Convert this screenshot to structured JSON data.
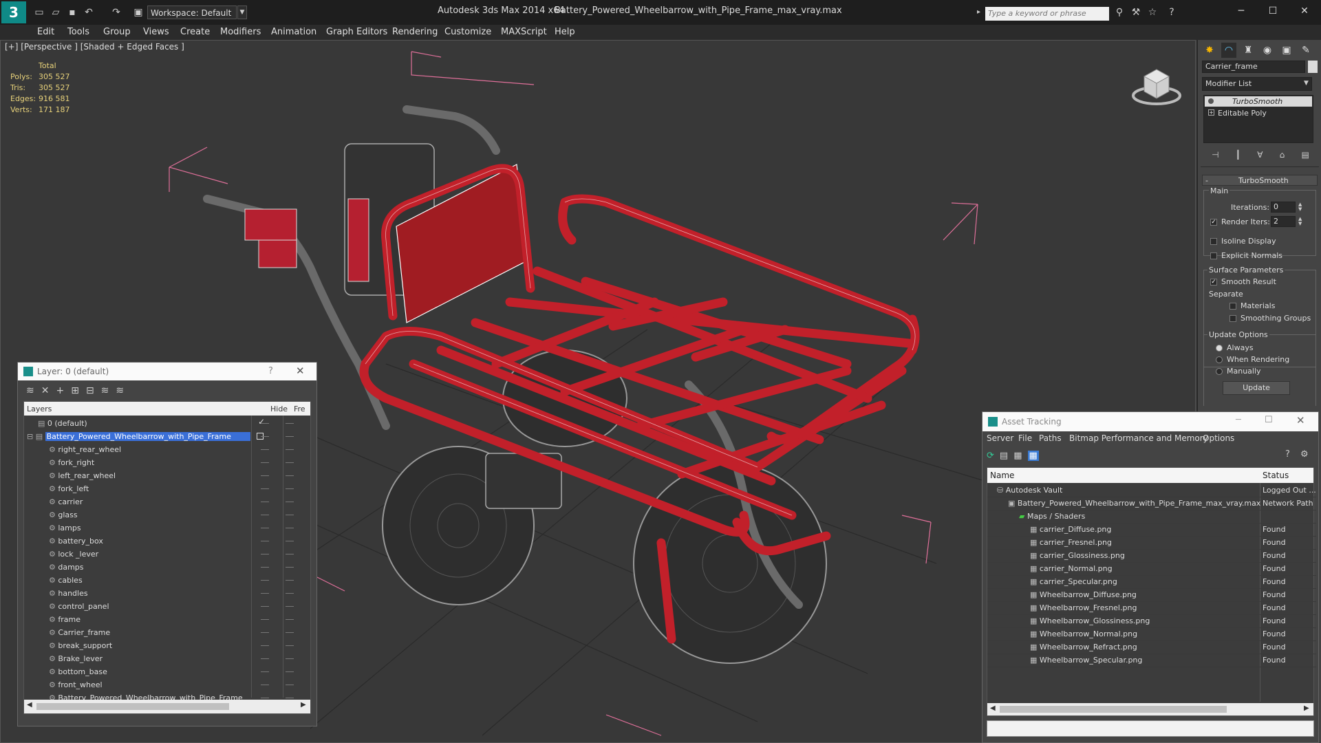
{
  "titlebar": {
    "app_title": "Autodesk 3ds Max  2014 x64",
    "doc_title": "Battery_Powered_Wheelbarrow_with_Pipe_Frame_max_vray.max",
    "workspace": "Workspace: Default",
    "search_placeholder": "Type a keyword or phrase"
  },
  "menu": [
    "Edit",
    "Tools",
    "Group",
    "Views",
    "Create",
    "Modifiers",
    "Animation",
    "Graph Editors",
    "Rendering",
    "Customize",
    "MAXScript",
    "Help"
  ],
  "viewport": {
    "label": "[+] [Perspective ] [Shaded + Edged Faces ]",
    "stats": {
      "header": "Total",
      "rows": [
        {
          "label": "Polys:",
          "value": "305 527"
        },
        {
          "label": "Tris:",
          "value": "305 527"
        },
        {
          "label": "Edges:",
          "value": "916 581"
        },
        {
          "label": "Verts:",
          "value": "171 187"
        }
      ]
    }
  },
  "command_panel": {
    "object_name": "Carrier_frame",
    "modifier_list": "Modifier List",
    "stack": [
      "TurboSmooth",
      "Editable Poly"
    ],
    "rollout_title": "TurboSmooth",
    "main_label": "Main",
    "iterations_label": "Iterations:",
    "iterations_value": "0",
    "render_iters_label": "Render Iters:",
    "render_iters_value": "2",
    "isoline": "Isoline Display",
    "explicit_normals": "Explicit Normals",
    "surface_params": "Surface Parameters",
    "smooth_result": "Smooth Result",
    "separate": "Separate",
    "materials": "Materials",
    "smoothing_groups": "Smoothing Groups",
    "update_options": "Update Options",
    "always": "Always",
    "when_rendering": "When Rendering",
    "manually": "Manually",
    "update_button": "Update"
  },
  "layer_panel": {
    "title": "Layer: 0 (default)",
    "help": "?",
    "col_layers": "Layers",
    "col_hide": "Hide",
    "col_freeze": "Fre",
    "default_layer": "0 (default)",
    "selected_layer": "Battery_Powered_Wheelbarrow_with_Pipe_Frame",
    "objects": [
      "right_rear_wheel",
      "fork_right",
      "left_rear_wheel",
      "fork_left",
      "carrier",
      "glass",
      "lamps",
      "battery_box",
      "lock _lever",
      "damps",
      "cables",
      "handles",
      "control_panel",
      "frame",
      "Carrier_frame",
      "break_support",
      "Brake_lever",
      "bottom_base",
      "front_wheel",
      "Battery_Powered_Wheelbarrow_with_Pipe_Frame"
    ]
  },
  "asset_tracking": {
    "title": "Asset Tracking",
    "menu": [
      "Server",
      "File",
      "Paths",
      "Bitmap Performance and Memory",
      "Options"
    ],
    "col_name": "Name",
    "col_status": "Status",
    "rows": [
      {
        "name": "Autodesk Vault",
        "status": "Logged Out ...",
        "indent": 1
      },
      {
        "name": "Battery_Powered_Wheelbarrow_with_Pipe_Frame_max_vray.max",
        "status": "Network Path",
        "indent": 2
      },
      {
        "name": "Maps / Shaders",
        "status": "",
        "indent": 3
      },
      {
        "name": "carrier_Diffuse.png",
        "status": "Found",
        "indent": 4
      },
      {
        "name": "carrier_Fresnel.png",
        "status": "Found",
        "indent": 4
      },
      {
        "name": "carrier_Glossiness.png",
        "status": "Found",
        "indent": 4
      },
      {
        "name": "carrier_Normal.png",
        "status": "Found",
        "indent": 4
      },
      {
        "name": "carrier_Specular.png",
        "status": "Found",
        "indent": 4
      },
      {
        "name": "Wheelbarrow_Diffuse.png",
        "status": "Found",
        "indent": 4
      },
      {
        "name": "Wheelbarrow_Fresnel.png",
        "status": "Found",
        "indent": 4
      },
      {
        "name": "Wheelbarrow_Glossiness.png",
        "status": "Found",
        "indent": 4
      },
      {
        "name": "Wheelbarrow_Normal.png",
        "status": "Found",
        "indent": 4
      },
      {
        "name": "Wheelbarrow_Refract.png",
        "status": "Found",
        "indent": 4
      },
      {
        "name": "Wheelbarrow_Specular.png",
        "status": "Found",
        "indent": 4
      }
    ]
  }
}
